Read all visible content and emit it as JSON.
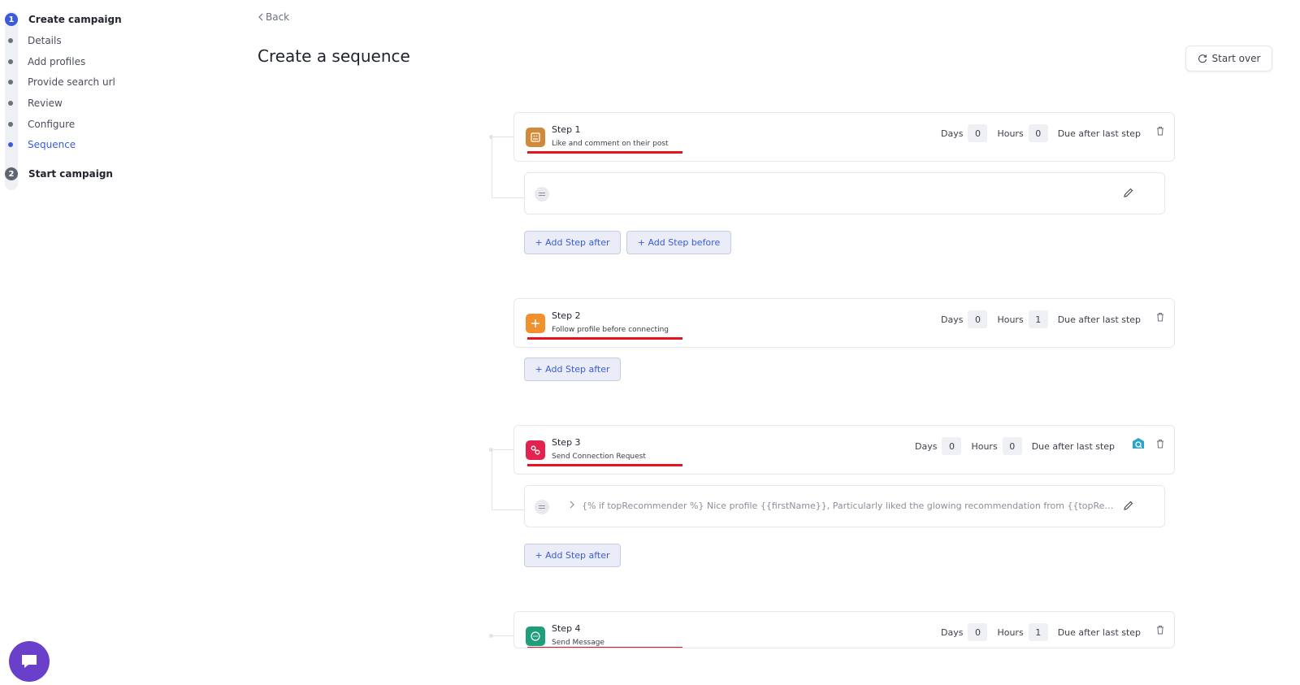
{
  "sidebar": {
    "stages": [
      {
        "num": "1",
        "label": "Create campaign"
      },
      {
        "num": "2",
        "label": "Start campaign"
      }
    ],
    "substeps": [
      "Details",
      "Add profiles",
      "Provide search url",
      "Review",
      "Configure",
      "Sequence"
    ]
  },
  "header": {
    "back_label": "Back",
    "title": "Create a sequence",
    "start_over_label": "Start over"
  },
  "labels": {
    "days": "Days",
    "hours": "Hours",
    "due": "Due after last step",
    "add_after": "+ Add Step after",
    "add_before": "+ Add Step before"
  },
  "steps": [
    {
      "title": "Step 1",
      "subtitle": "Like and comment on their post",
      "days": "0",
      "hours": "0",
      "icon": "image-icon",
      "color": "#d08a3a"
    },
    {
      "title": "Step 2",
      "subtitle": "Follow profile before connecting",
      "days": "0",
      "hours": "1",
      "icon": "plus-icon",
      "color": "#f0912e"
    },
    {
      "title": "Step 3",
      "subtitle": "Send Connection Request",
      "days": "0",
      "hours": "0",
      "icon": "link-icon",
      "color": "#e3234f"
    },
    {
      "title": "Step 4",
      "subtitle": "Send Message",
      "days": "0",
      "hours": "1",
      "icon": "chat-icon",
      "color": "#1e9e7a"
    }
  ],
  "messages": [
    {
      "text": ""
    },
    {
      "text": "{% if topRecommender %} Nice profile {{firstName}}, Particularly liked the glowing recommendation from {{topRecommender}}"
    }
  ],
  "colors": {
    "accent": "#3b5bdb",
    "highlight_underline": "#e8121c",
    "chat_bubble": "#6a3fc9"
  }
}
